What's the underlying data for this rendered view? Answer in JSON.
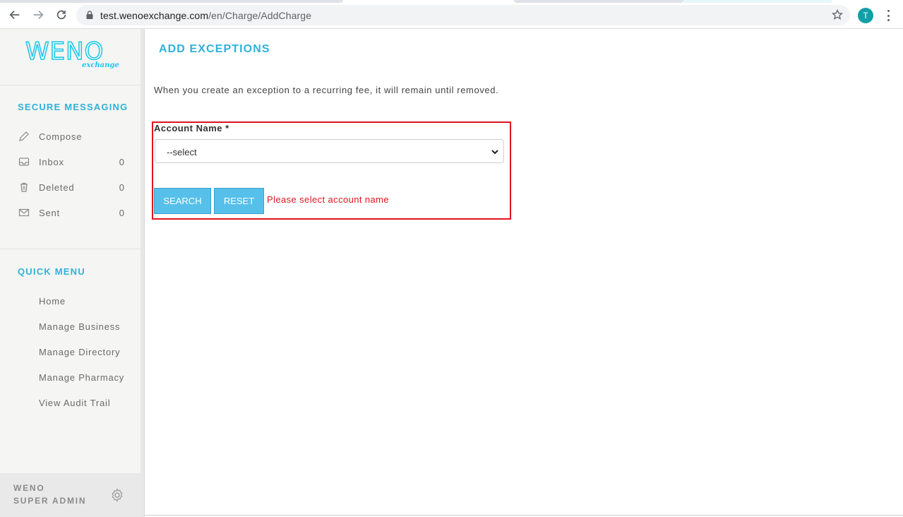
{
  "browser": {
    "url_domain": "test.wenoexchange.com",
    "url_path": "/en/Charge/AddCharge",
    "profile_initial": "T"
  },
  "sidebar": {
    "logo_main": "WENO",
    "logo_sub": "exchange",
    "secure_messaging_title": "SECURE MESSAGING",
    "messaging_items": [
      {
        "label": "Compose",
        "count": "",
        "icon": "pencil-icon"
      },
      {
        "label": "Inbox",
        "count": "0",
        "icon": "inbox-icon"
      },
      {
        "label": "Deleted",
        "count": "0",
        "icon": "trash-icon"
      },
      {
        "label": "Sent",
        "count": "0",
        "icon": "envelope-icon"
      }
    ],
    "quick_menu_title": "QUICK MENU",
    "quick_items": [
      {
        "label": "Home"
      },
      {
        "label": "Manage Business"
      },
      {
        "label": "Manage Directory"
      },
      {
        "label": "Manage Pharmacy"
      },
      {
        "label": "View Audit Trail"
      }
    ],
    "footer_line1": "WENO",
    "footer_line2": "SUPER ADMIN"
  },
  "main": {
    "title": "ADD EXCEPTIONS",
    "intro": "When you create an exception to a recurring fee, it will remain until removed.",
    "account_label": "Account Name *",
    "account_select_value": "--select",
    "search_label": "SEARCH",
    "reset_label": "RESET",
    "error_message": "Please select account name"
  },
  "colors": {
    "accent": "#2fb2d8",
    "button": "#56c0ea",
    "error": "#e0141e",
    "logo": "#1ec8e8"
  }
}
